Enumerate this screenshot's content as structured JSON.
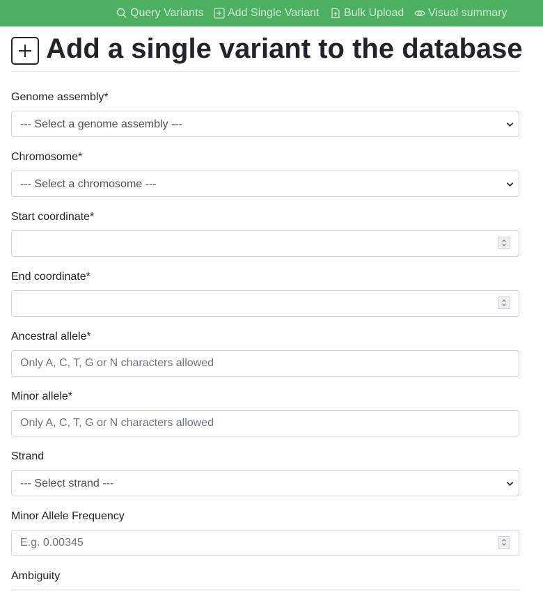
{
  "nav": {
    "items": [
      {
        "label": "Query Variants",
        "icon": "search-icon"
      },
      {
        "label": "Add Single Variant",
        "icon": "plus-square-icon"
      },
      {
        "label": "Bulk Upload",
        "icon": "file-icon"
      },
      {
        "label": "Visual summary",
        "icon": "eye-icon"
      }
    ]
  },
  "page": {
    "title": "Add a single variant to the database",
    "title_icon": "plus-square-icon"
  },
  "form": {
    "genome_assembly": {
      "label": "Genome assembly*",
      "value": "--- Select a genome assembly ---"
    },
    "chromosome": {
      "label": "Chromosome*",
      "value": "--- Select a chromosome ---"
    },
    "start_coordinate": {
      "label": "Start coordinate*",
      "value": "",
      "placeholder": ""
    },
    "end_coordinate": {
      "label": "End coordinate*",
      "value": "",
      "placeholder": ""
    },
    "ancestral_allele": {
      "label": "Ancestral allele*",
      "value": "",
      "placeholder": "Only A, C, T, G or N characters allowed"
    },
    "minor_allele": {
      "label": "Minor allele*",
      "value": "",
      "placeholder": "Only A, C, T, G or N characters allowed"
    },
    "strand": {
      "label": "Strand",
      "value": "--- Select strand ---"
    },
    "minor_allele_frequency": {
      "label": "Minor Allele Frequency",
      "value": "",
      "placeholder": "E.g. 0.00345"
    },
    "ambiguity": {
      "label": "Ambiguity"
    }
  },
  "colors": {
    "navbar": "#4caf62",
    "nav_text": "#c9ecd2",
    "border": "#ced4da",
    "text": "#212529",
    "placeholder": "#6c757d"
  }
}
